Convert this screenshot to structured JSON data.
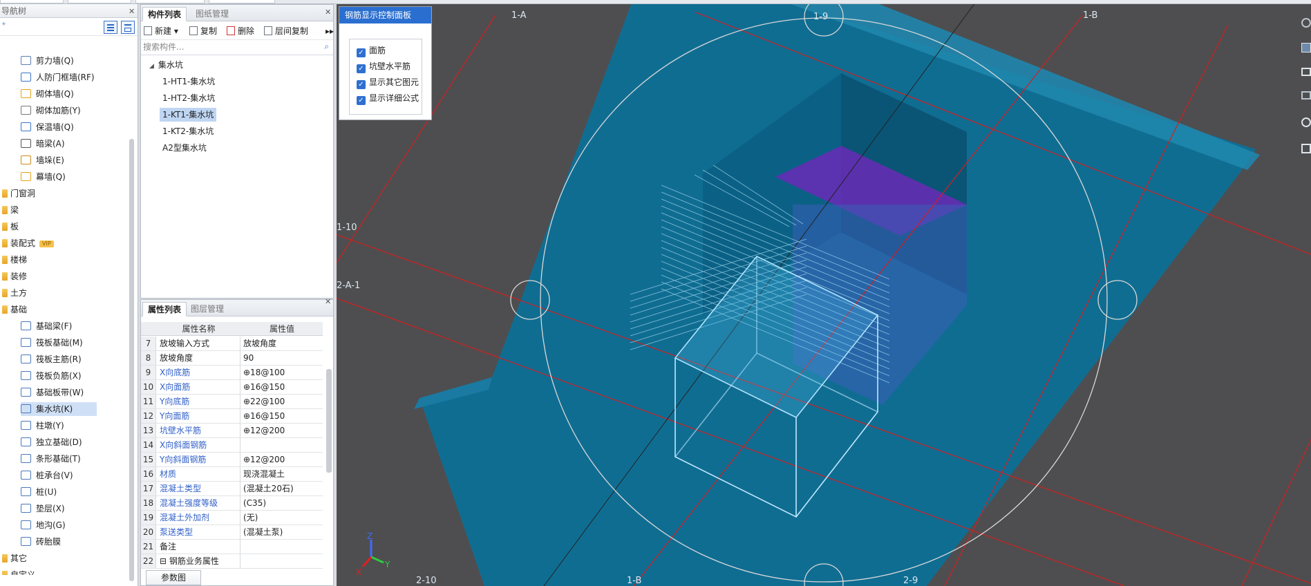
{
  "nav": {
    "title": "导航树",
    "items": [
      {
        "label": "剪力墙(Q)",
        "icon": "shear-wall-icon"
      },
      {
        "label": "人防门框墙(RF)",
        "icon": "civil-defense-door-wall-icon"
      },
      {
        "label": "砌体墙(Q)",
        "icon": "masonry-wall-icon"
      },
      {
        "label": "砌体加筋(Y)",
        "icon": "masonry-rebar-icon"
      },
      {
        "label": "保温墙(Q)",
        "icon": "insulation-wall-icon"
      },
      {
        "label": "暗梁(A)",
        "icon": "hidden-beam-icon"
      },
      {
        "label": "墙垛(E)",
        "icon": "wall-pier-icon"
      },
      {
        "label": "幕墙(Q)",
        "icon": "curtain-wall-icon"
      }
    ],
    "categories": [
      "门窗洞",
      "梁",
      "板",
      "装配式",
      "楼梯",
      "装修",
      "土方",
      "基础"
    ],
    "vip_badge": "VIP",
    "foundation_items": [
      {
        "label": "基础梁(F)",
        "icon": "foundation-beam-icon"
      },
      {
        "label": "筏板基础(M)",
        "icon": "raft-foundation-icon"
      },
      {
        "label": "筏板主筋(R)",
        "icon": "raft-main-rebar-icon"
      },
      {
        "label": "筏板负筋(X)",
        "icon": "raft-negative-rebar-icon"
      },
      {
        "label": "基础板带(W)",
        "icon": "foundation-strip-icon"
      },
      {
        "label": "集水坑(K)",
        "icon": "sump-pit-icon"
      },
      {
        "label": "柱墩(Y)",
        "icon": "column-pier-icon"
      },
      {
        "label": "独立基础(D)",
        "icon": "isolated-foundation-icon"
      },
      {
        "label": "条形基础(T)",
        "icon": "strip-foundation-icon"
      },
      {
        "label": "桩承台(V)",
        "icon": "pile-cap-icon"
      },
      {
        "label": "桩(U)",
        "icon": "pile-icon"
      },
      {
        "label": "垫层(X)",
        "icon": "cushion-layer-icon"
      },
      {
        "label": "地沟(G)",
        "icon": "trench-icon"
      },
      {
        "label": "砖胎膜",
        "icon": "brick-formwork-icon"
      }
    ],
    "bottom_categories": [
      "其它",
      "自定义"
    ]
  },
  "components": {
    "tabs": [
      "构件列表",
      "图纸管理"
    ],
    "toolbar": {
      "new": "新建",
      "copy": "复制",
      "delete": "删除",
      "floor_copy": "层间复制"
    },
    "search_placeholder": "搜索构件...",
    "root": "集水坑",
    "items": [
      "1-HT1-集水坑",
      "1-HT2-集水坑",
      "1-KT1-集水坑",
      "1-KT2-集水坑",
      "A2型集水坑"
    ],
    "selected": "1-KT1-集水坑"
  },
  "properties": {
    "tabs": [
      "属性列表",
      "图层管理"
    ],
    "header_name": "属性名称",
    "header_value": "属性值",
    "rows": [
      {
        "n": "7",
        "k": "放坡输入方式",
        "v": "放坡角度",
        "link": false
      },
      {
        "n": "8",
        "k": "放坡角度",
        "v": "90",
        "link": false
      },
      {
        "n": "9",
        "k": "X向底筋",
        "v": "⊕18@100",
        "link": true
      },
      {
        "n": "10",
        "k": "X向面筋",
        "v": "⊕16@150",
        "link": true
      },
      {
        "n": "11",
        "k": "Y向底筋",
        "v": "⊕22@100",
        "link": true
      },
      {
        "n": "12",
        "k": "Y向面筋",
        "v": "⊕16@150",
        "link": true
      },
      {
        "n": "13",
        "k": "坑壁水平筋",
        "v": "⊕12@200",
        "link": true
      },
      {
        "n": "14",
        "k": "X向斜面钢筋",
        "v": "",
        "link": true
      },
      {
        "n": "15",
        "k": "Y向斜面钢筋",
        "v": "⊕12@200",
        "link": true
      },
      {
        "n": "16",
        "k": "材质",
        "v": "现浇混凝土",
        "link": true
      },
      {
        "n": "17",
        "k": "混凝土类型",
        "v": "(混凝土20石)",
        "link": true
      },
      {
        "n": "18",
        "k": "混凝土强度等级",
        "v": "(C35)",
        "link": true
      },
      {
        "n": "19",
        "k": "混凝土外加剂",
        "v": "(无)",
        "link": true
      },
      {
        "n": "20",
        "k": "泵送类型",
        "v": "(混凝土泵)",
        "link": true
      },
      {
        "n": "21",
        "k": "备注",
        "v": "",
        "link": false
      },
      {
        "n": "22",
        "k": "⊟ 钢筋业务属性",
        "v": "",
        "link": false
      }
    ],
    "param_button": "参数图"
  },
  "rebar_panel": {
    "title": "钢筋显示控制面板",
    "options": [
      "面筋",
      "坑壁水平筋",
      "显示其它图元",
      "显示详细公式"
    ]
  },
  "viewport": {
    "axis_labels": [
      "1-A",
      "1-9",
      "1-B",
      "1-10",
      "2-A-1",
      "2-10",
      "1-B",
      "2-9"
    ],
    "gizmo": {
      "x": "X",
      "y": "Y",
      "z": "Z"
    },
    "colors": {
      "background": "#4e4e50",
      "slab": "#0d6f96",
      "pit": "#3a5fb8",
      "bottom": "#6a2ab6",
      "grid_line": "#d21f1f"
    }
  }
}
